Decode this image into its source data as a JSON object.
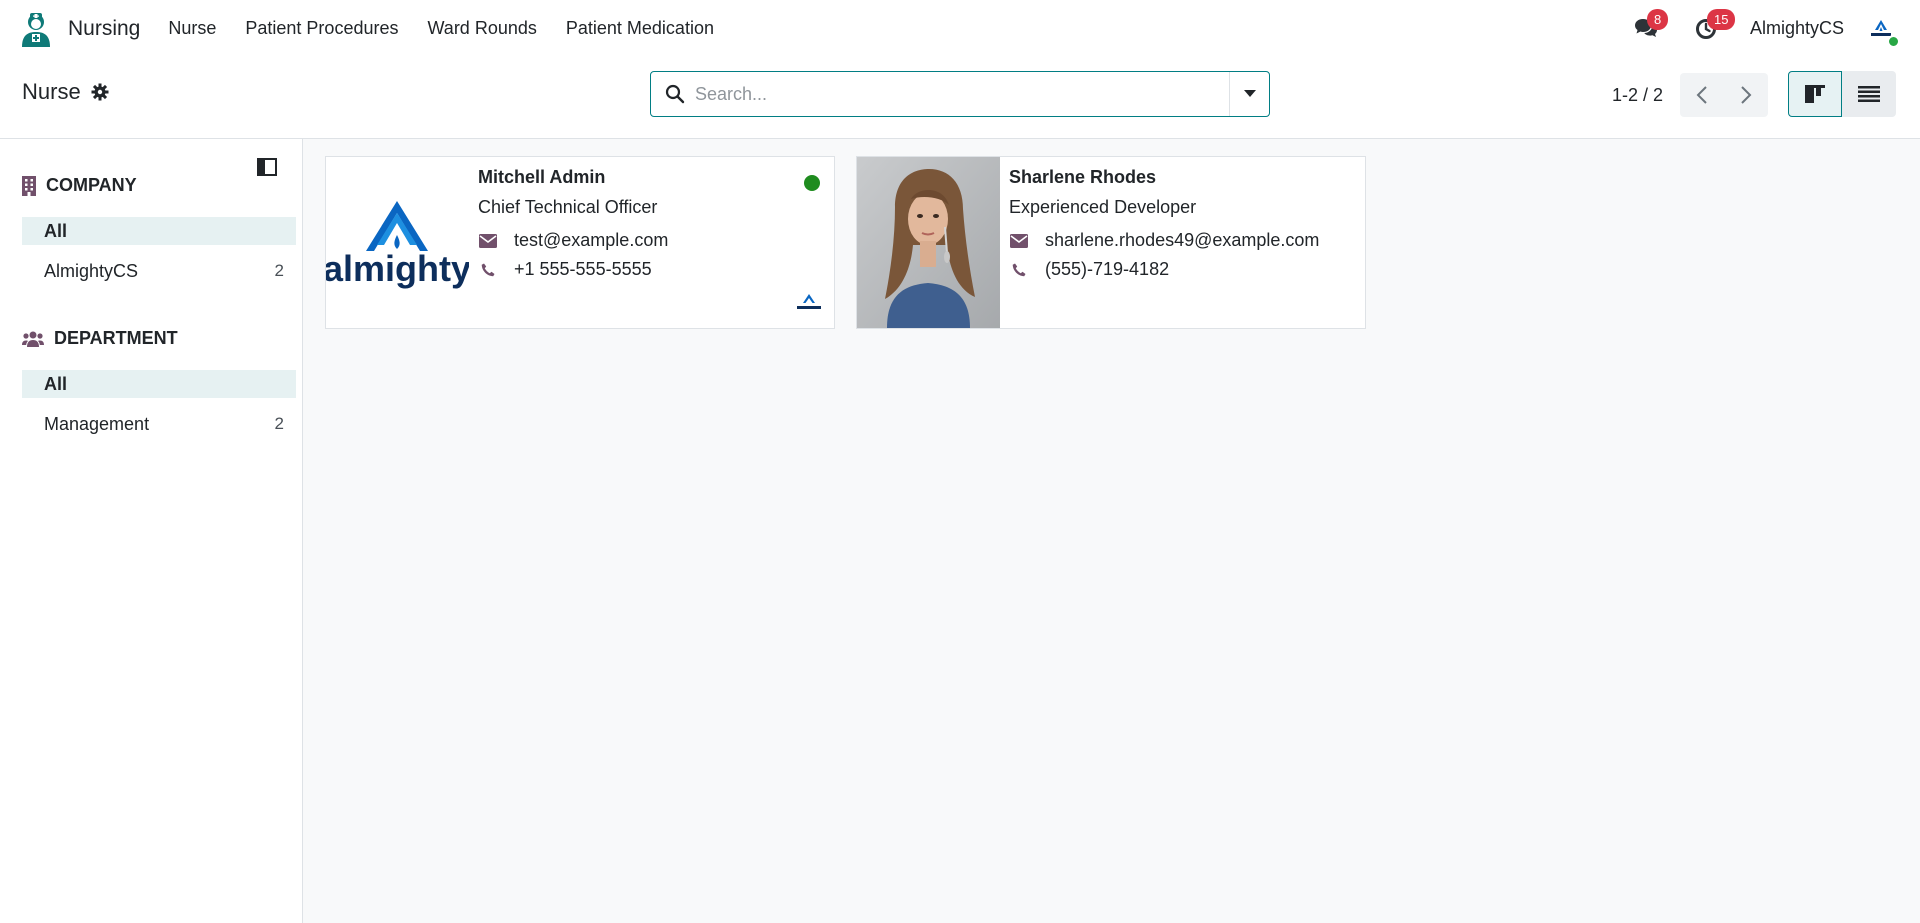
{
  "app": {
    "name": "Nursing",
    "menu": [
      {
        "label": "Nurse"
      },
      {
        "label": "Patient Procedures"
      },
      {
        "label": "Ward Rounds"
      },
      {
        "label": "Patient Medication"
      }
    ]
  },
  "systray": {
    "messages_count": "8",
    "activities_count": "15",
    "company": "AlmightyCS"
  },
  "control": {
    "title": "Nurse",
    "search_placeholder": "Search...",
    "pager": "1-2 / 2"
  },
  "sidebar": {
    "company": {
      "heading": "COMPANY",
      "items": [
        {
          "label": "All",
          "count": ""
        },
        {
          "label": "AlmightyCS",
          "count": "2"
        }
      ]
    },
    "department": {
      "heading": "DEPARTMENT",
      "items": [
        {
          "label": "All",
          "count": ""
        },
        {
          "label": "Management",
          "count": "2"
        }
      ]
    }
  },
  "cards": [
    {
      "name": "Mitchell Admin",
      "job": "Chief Technical Officer",
      "email": "test@example.com",
      "phone": "+1 555-555-5555",
      "logo_text": "almighty"
    },
    {
      "name": "Sharlene Rhodes",
      "job": "Experienced Developer",
      "email": "sharlene.rhodes49@example.com",
      "phone": "(555)-719-4182"
    }
  ],
  "colors": {
    "brand_teal": "#017e84",
    "icon_purple": "#71506b",
    "badge_red": "#dc3545",
    "online_green": "#28a745",
    "logo_blue": "#0a66c2",
    "logo_navy": "#0d2e5c"
  }
}
